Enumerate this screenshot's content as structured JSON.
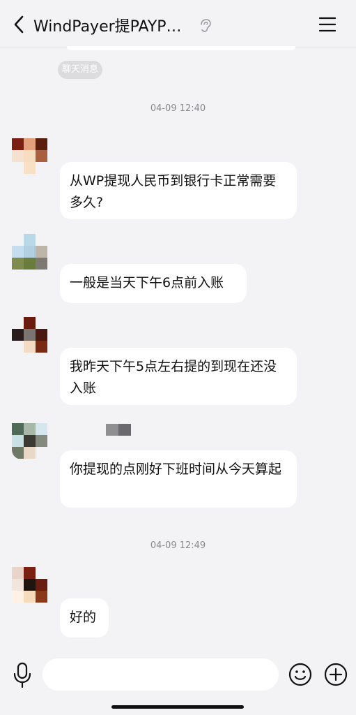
{
  "header": {
    "title": "WindPayer提PAYP…",
    "back_icon": "chevron-left-icon",
    "ear_icon": "ear-icon",
    "menu_icon": "menu-icon"
  },
  "system_pill": "聊天消息",
  "timestamps": [
    "04-09 12:40",
    "04-09 12:49"
  ],
  "messages": [
    {
      "text": "从WP提现人民币到银行卡正常需要多久?"
    },
    {
      "text": "一般是当天下午6点前入账"
    },
    {
      "text": "我昨天下午5点左右提的到现在还没入账"
    },
    {
      "text": "你提现的点刚好下班时间从今天算起"
    },
    {
      "text": "好的"
    }
  ],
  "input_bar": {
    "voice_icon": "microphone-icon",
    "emoji_icon": "emoji-icon",
    "add_icon": "plus-circle-icon"
  },
  "colors": {
    "background": "#f3f3f5",
    "bubble": "#ffffff",
    "timestamp": "#8a8a8e"
  }
}
